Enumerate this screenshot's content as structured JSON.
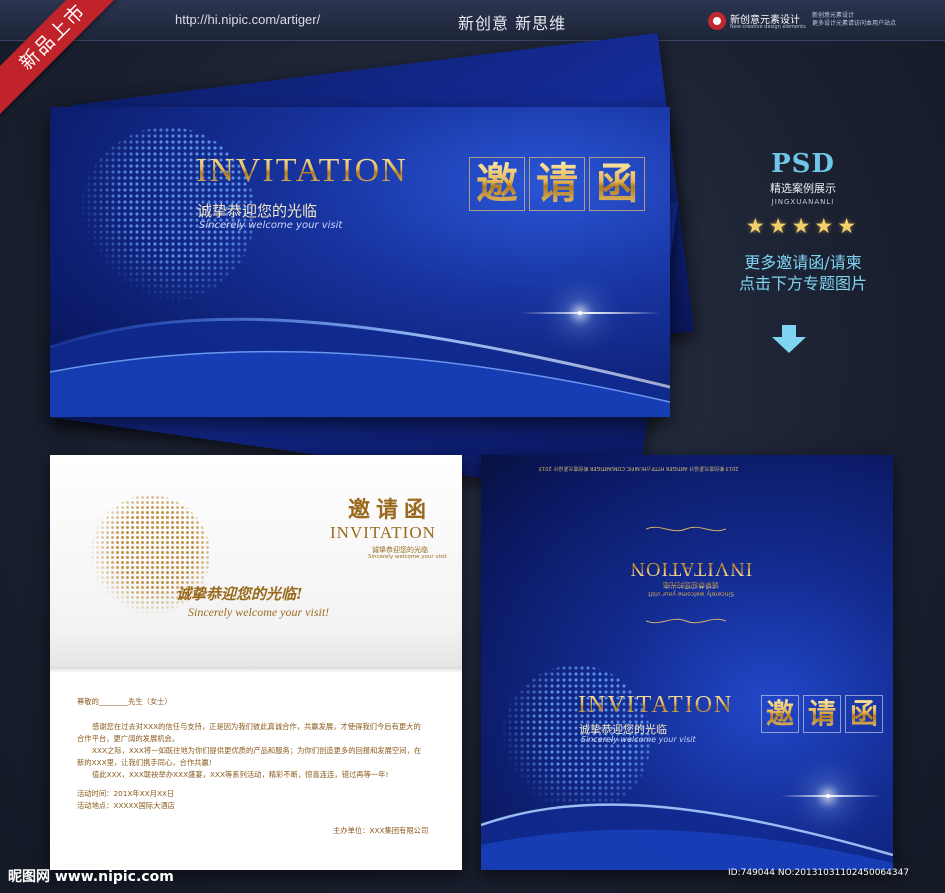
{
  "header": {
    "url": "http://hi.nipic.com/artiger/",
    "slogan": "新创意  新思维",
    "brand_name": "新创意元素设计",
    "brand_sub": "New creative design elements",
    "brand_right_line1": "新创意元素设计",
    "brand_right_line2": "更多设计元素请访问本用户站点"
  },
  "ribbon": "新品上市",
  "cover": {
    "title_en": "INVITATION",
    "title_cn_chars": [
      "邀",
      "请",
      "函"
    ],
    "subtitle_cn": "诚挚恭迎您的光临",
    "subtitle_en": "Sincerely welcome your visit"
  },
  "side": {
    "psd": "PSD",
    "line1": "精选案例展示",
    "line2": "JINGXUANANLI",
    "stars": "★★★★★",
    "promo1": "更多邀请函/请柬",
    "promo2": "点击下方专题图片"
  },
  "inner": {
    "title_cn": "邀请函",
    "title_en": "INVITATION",
    "sub_cn_small": "诚挚恭迎您的光临",
    "sub_en_small": "Sincerely welcome your visit",
    "headline_cn": "诚挚恭迎您的光临!",
    "headline_en": "Sincerely welcome your visit!",
    "salutation": "尊敬的________先生（女士）",
    "para1a": "感谢您在过去对XXX的信任与支持，正是因为我们彼此真诚合作，共赢发展，才使得我们今后有更大的",
    "para1b": "合作平台，更广阔的发展机会。",
    "para2a": "XXX之际，XXX将一如既往地为你们提供更优质的产品和服务；为你们创造更多的回报和发展空间，在",
    "para2b": "新的XXX里，让我们携手同心，合作共赢!",
    "para3": "值此XXX，XXX联袂举办XXX盛宴，XXX等系列活动，精彩不断，惊喜连连，错过再等一年!",
    "time": "活动时间：201X年XX月XX日",
    "place": "活动地点：XXXXX国际大酒店",
    "host": "主办单位：XXX集团有限公司"
  },
  "back": {
    "top_text": "2013 新创意元素设计 ARTIGER  HTTP://HI.NIPIC.COM/ARTIGER  新创意元素设计  2013",
    "mirror_title": "INVITATION",
    "mirror_sub_cn": "诚挚恭迎您的光临",
    "mirror_sub_en": "Sincerely welcome your visit",
    "title_en": "INVITATION",
    "title_cn_chars": [
      "邀",
      "请",
      "函"
    ],
    "subtitle_cn": "诚挚恭迎您的光临",
    "subtitle_en": "Sincerely welcome your visit"
  },
  "footer": {
    "site": "昵图网 www.nipic.com",
    "id": "ID:749044 NO:20131031102450064347"
  }
}
